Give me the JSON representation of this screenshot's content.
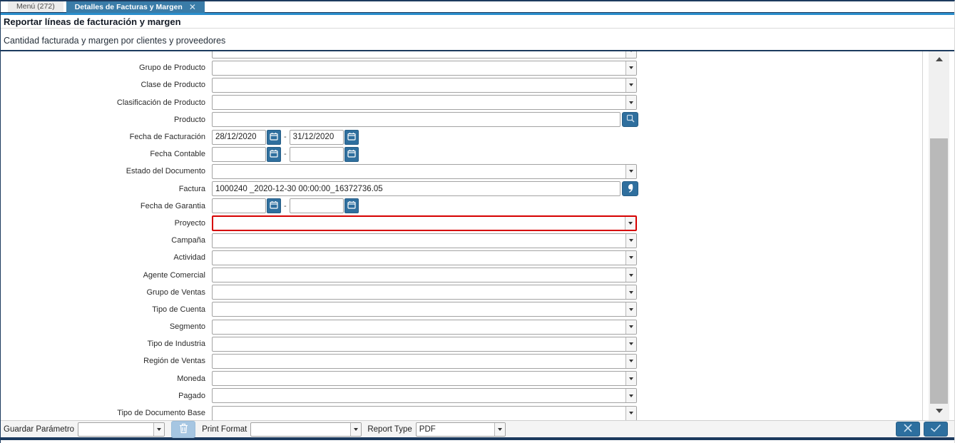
{
  "tabs": [
    {
      "label": "Menú (272)"
    },
    {
      "label": "Detalles de Facturas y Margen",
      "closable": true
    }
  ],
  "header": {
    "title": "Reportar líneas de facturación y margen",
    "subtitle": "Cantidad facturada y margen por clientes y proveedores"
  },
  "form": {
    "rows": [
      {
        "label": "",
        "type": "select",
        "name": "clipped-top-field",
        "partial": true
      },
      {
        "label": "Grupo de Producto",
        "type": "select",
        "name": "grupo-de-producto"
      },
      {
        "label": "Clase de Producto",
        "type": "select",
        "name": "clase-de-producto"
      },
      {
        "label": "Clasificación de Producto",
        "type": "select",
        "name": "clasificacion-de-producto"
      },
      {
        "label": "Producto",
        "type": "lookup",
        "name": "producto",
        "value": "",
        "icon": "product-search-icon"
      },
      {
        "label": "Fecha de Facturación",
        "type": "daterange",
        "name": "fecha-de-facturacion",
        "from": "28/12/2020",
        "to": "31/12/2020"
      },
      {
        "label": "Fecha Contable",
        "type": "daterange",
        "name": "fecha-contable",
        "from": "",
        "to": ""
      },
      {
        "label": "Estado del Documento",
        "type": "select",
        "name": "estado-del-documento"
      },
      {
        "label": "Factura",
        "type": "lookup",
        "name": "factura",
        "value": "1000240 _2020-12-30 00:00:00_16372736.05",
        "icon": "invoice-info-icon"
      },
      {
        "label": "Fecha de Garantia",
        "type": "daterange",
        "name": "fecha-de-garantia",
        "from": "",
        "to": ""
      },
      {
        "label": "Proyecto",
        "type": "select",
        "name": "proyecto",
        "highlight": true
      },
      {
        "label": "Campaña",
        "type": "select",
        "name": "campana"
      },
      {
        "label": "Actividad",
        "type": "select",
        "name": "actividad"
      },
      {
        "label": "Agente Comercial",
        "type": "select",
        "name": "agente-comercial"
      },
      {
        "label": "Grupo de Ventas",
        "type": "select",
        "name": "grupo-de-ventas"
      },
      {
        "label": "Tipo de Cuenta",
        "type": "select",
        "name": "tipo-de-cuenta"
      },
      {
        "label": "Segmento",
        "type": "select",
        "name": "segmento"
      },
      {
        "label": "Tipo de Industria",
        "type": "select",
        "name": "tipo-de-industria"
      },
      {
        "label": "Región de Ventas",
        "type": "select",
        "name": "region-de-ventas"
      },
      {
        "label": "Moneda",
        "type": "select",
        "name": "moneda"
      },
      {
        "label": "Pagado",
        "type": "select",
        "name": "pagado"
      },
      {
        "label": "Tipo de Documento Base",
        "type": "select",
        "name": "tipo-de-documento-base"
      }
    ]
  },
  "footer": {
    "save_param_label": "Guardar Parámetro",
    "print_format_label": "Print Format",
    "report_type_label": "Report Type",
    "report_type_value": "PDF"
  },
  "colors": {
    "accent_blue": "#2a8dcb",
    "tab_active": "#3a7ca8",
    "button_blue": "#2f6f9e",
    "frame_navy": "#1c3a5e",
    "highlight_red": "#d60000",
    "trash_disabled": "#a6c6e2"
  }
}
